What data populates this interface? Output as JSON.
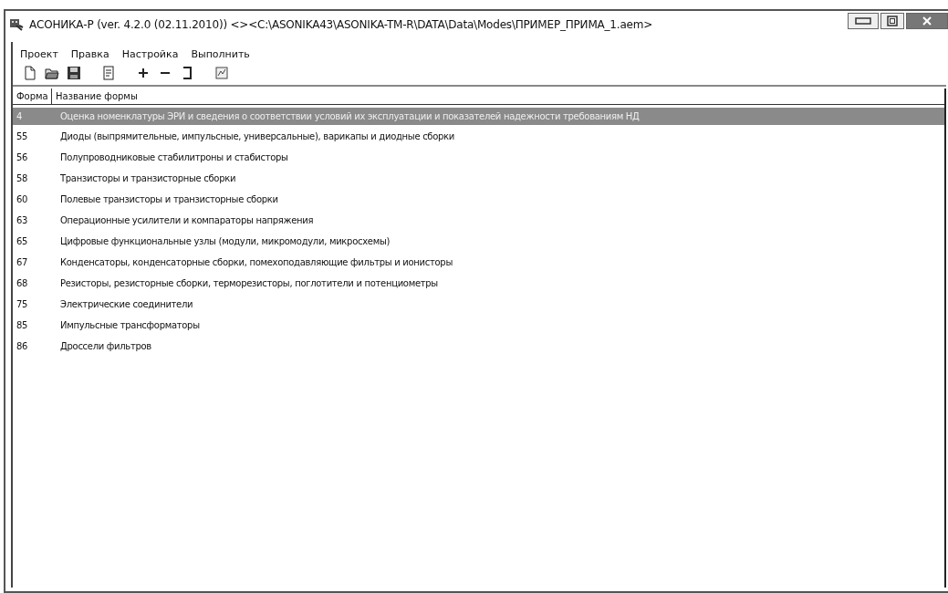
{
  "window": {
    "title": "АСОНИКА-Р (ver. 4.2.0 (02.11.2010)) <><C:\\ASONIKA43\\ASONIKA-TM-R\\DATA\\Data\\Modes\\ПРИМЕР_ПРИМА_1.aem>"
  },
  "menu": [
    "Проект",
    "Правка",
    "Настройка",
    "Выполнить"
  ],
  "toolbar": [
    {
      "kind": "new"
    },
    {
      "kind": "open"
    },
    {
      "kind": "save"
    },
    {
      "kind": "sep"
    },
    {
      "kind": "report"
    },
    {
      "kind": "sep"
    },
    {
      "kind": "add"
    },
    {
      "kind": "remove"
    },
    {
      "kind": "bracket"
    },
    {
      "kind": "sep"
    },
    {
      "kind": "form"
    }
  ],
  "table": {
    "columns": [
      "Форма",
      "Название формы"
    ],
    "rows": [
      {
        "form": "4",
        "name": "Оценка номенклатуры ЭРИ и сведения о соответствии условий их эксплуатации и показателей надежности требованиям НД",
        "selected": true
      },
      {
        "form": "55",
        "name": "Диоды (выпрямительные, импульсные, универсальные), варикапы и диодные сборки",
        "selected": false
      },
      {
        "form": "56",
        "name": "Полупроводниковые стабилитроны и стабисторы",
        "selected": false
      },
      {
        "form": "58",
        "name": "Транзисторы и транзисторные сборки",
        "selected": false
      },
      {
        "form": "60",
        "name": "Полевые транзисторы и транзисторные сборки",
        "selected": false
      },
      {
        "form": "63",
        "name": "Операционные усилители и компараторы напряжения",
        "selected": false
      },
      {
        "form": "65",
        "name": "Цифровые функциональные узлы (модули, микромодули, микросхемы)",
        "selected": false
      },
      {
        "form": "67",
        "name": "Конденсаторы, конденсаторные сборки, помехоподавляющие фильтры и ионисторы",
        "selected": false
      },
      {
        "form": "68",
        "name": "Резисторы, резисторные сборки, терморезисторы, поглотители и потенциометры",
        "selected": false
      },
      {
        "form": "75",
        "name": "Электрические соединители",
        "selected": false
      },
      {
        "form": "85",
        "name": "Импульсные трансформаторы",
        "selected": false
      },
      {
        "form": "86",
        "name": "Дроссели фильтров",
        "selected": false
      }
    ]
  }
}
